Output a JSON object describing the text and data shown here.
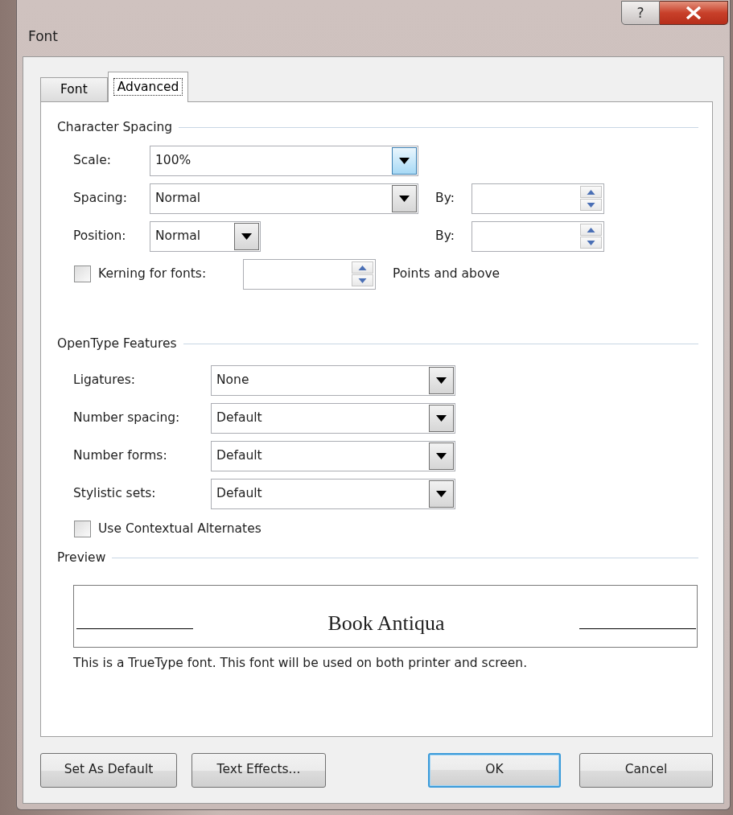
{
  "window": {
    "title": "Font",
    "help_button": "?"
  },
  "tabs": [
    {
      "label": "Font",
      "selected": false
    },
    {
      "label": "Advanced",
      "selected": true
    }
  ],
  "character_spacing": {
    "heading": "Character Spacing",
    "scale": {
      "label": "Scale:",
      "value": "100%",
      "arrow_highlighted": true
    },
    "spacing": {
      "label": "Spacing:",
      "value": "Normal",
      "by_label": "By:"
    },
    "position": {
      "label": "Position:",
      "value": "Normal",
      "by_label": "By:"
    },
    "kerning": {
      "label": "Kerning for fonts:",
      "checked": false,
      "suffix": "Points and above"
    }
  },
  "opentype_features": {
    "heading": "OpenType Features",
    "selects": [
      {
        "label": "Ligatures:",
        "value": "None"
      },
      {
        "label": "Number spacing:",
        "value": "Default"
      },
      {
        "label": "Number forms:",
        "value": "Default"
      },
      {
        "label": "Stylistic sets:",
        "value": "Default"
      }
    ],
    "contextual_alternates": {
      "label": "Use Contextual Alternates",
      "checked": false
    }
  },
  "preview": {
    "heading": "Preview",
    "sample": "Book Antiqua",
    "note": "This is a TrueType font. This font will be used on both printer and screen."
  },
  "buttons": [
    {
      "label": "Set As Default",
      "default": false
    },
    {
      "label": "Text Effects...",
      "default": false
    },
    {
      "label": "OK",
      "default": true
    },
    {
      "label": "Cancel",
      "default": false
    }
  ]
}
